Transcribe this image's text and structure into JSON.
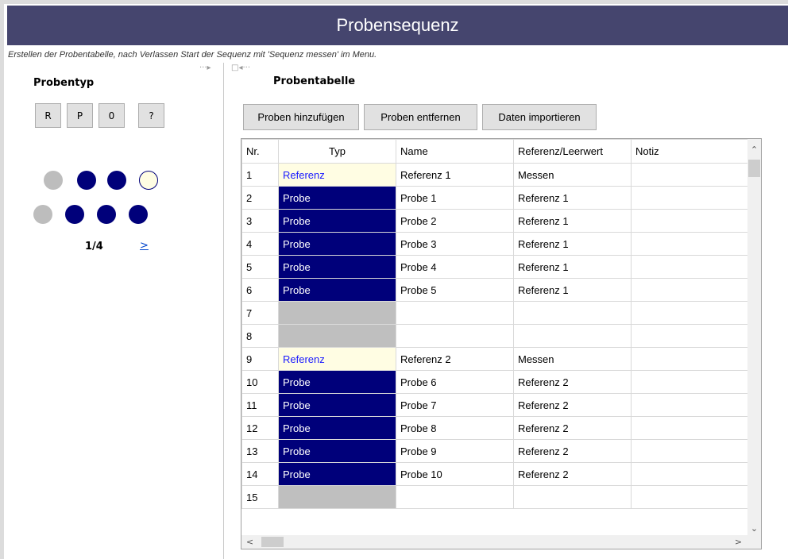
{
  "window": {
    "title": "Probensequenz"
  },
  "hint": "Erstellen der Probentabelle, nach Verlassen Start der Sequenz mit 'Sequenz messen' im Menu.",
  "left_panel": {
    "heading": "Probentyp",
    "type_buttons": [
      "R",
      "P",
      "0",
      "?"
    ],
    "tray_rows": [
      [
        "grey",
        "navy",
        "navy",
        "empty"
      ],
      [
        "grey",
        "navy",
        "navy",
        "navy"
      ]
    ],
    "page": "1/4",
    "next_label": ">"
  },
  "right_panel": {
    "heading": "Probentabelle",
    "buttons": {
      "add": "Proben hinzufügen",
      "remove": "Proben entfernen",
      "import": "Daten importieren"
    },
    "columns": [
      "Nr.",
      "Typ",
      "Name",
      "Referenz/Leerwert",
      "Notiz"
    ],
    "rows": [
      {
        "nr": "1",
        "typ": "Referenz",
        "kind": "ref",
        "name": "Referenz 1",
        "ref": "Messen",
        "note": ""
      },
      {
        "nr": "2",
        "typ": "Probe",
        "kind": "probe",
        "name": "Probe 1",
        "ref": "Referenz 1",
        "note": ""
      },
      {
        "nr": "3",
        "typ": "Probe",
        "kind": "probe",
        "name": "Probe 2",
        "ref": "Referenz 1",
        "note": ""
      },
      {
        "nr": "4",
        "typ": "Probe",
        "kind": "probe",
        "name": "Probe 3",
        "ref": "Referenz 1",
        "note": ""
      },
      {
        "nr": "5",
        "typ": "Probe",
        "kind": "probe",
        "name": "Probe 4",
        "ref": "Referenz 1",
        "note": ""
      },
      {
        "nr": "6",
        "typ": "Probe",
        "kind": "probe",
        "name": "Probe 5",
        "ref": "Referenz 1",
        "note": ""
      },
      {
        "nr": "7",
        "typ": "",
        "kind": "empty",
        "name": "",
        "ref": "",
        "note": ""
      },
      {
        "nr": "8",
        "typ": "",
        "kind": "empty",
        "name": "",
        "ref": "",
        "note": ""
      },
      {
        "nr": "9",
        "typ": "Referenz",
        "kind": "ref",
        "name": "Referenz 2",
        "ref": "Messen",
        "note": ""
      },
      {
        "nr": "10",
        "typ": "Probe",
        "kind": "probe",
        "name": "Probe 6",
        "ref": "Referenz 2",
        "note": ""
      },
      {
        "nr": "11",
        "typ": "Probe",
        "kind": "probe",
        "name": "Probe 7",
        "ref": "Referenz 2",
        "note": ""
      },
      {
        "nr": "12",
        "typ": "Probe",
        "kind": "probe",
        "name": "Probe 8",
        "ref": "Referenz 2",
        "note": ""
      },
      {
        "nr": "13",
        "typ": "Probe",
        "kind": "probe",
        "name": "Probe 9",
        "ref": "Referenz 2",
        "note": ""
      },
      {
        "nr": "14",
        "typ": "Probe",
        "kind": "probe",
        "name": "Probe 10",
        "ref": "Referenz 2",
        "note": ""
      },
      {
        "nr": "15",
        "typ": "",
        "kind": "empty",
        "name": "",
        "ref": "",
        "note": ""
      }
    ]
  },
  "colors": {
    "title_bar": "#45456e",
    "probe": "#00007a",
    "reference_bg": "#fffde3",
    "reference_text": "#1a1aff",
    "empty": "#bfbfbf"
  },
  "icons": {
    "collapse": "arrow-right-icon",
    "expand": "arrow-left-icon",
    "scroll_up": "chevron-up-icon",
    "scroll_down": "chevron-down-icon",
    "scroll_left": "chevron-left-icon",
    "scroll_right": "chevron-right-icon"
  }
}
